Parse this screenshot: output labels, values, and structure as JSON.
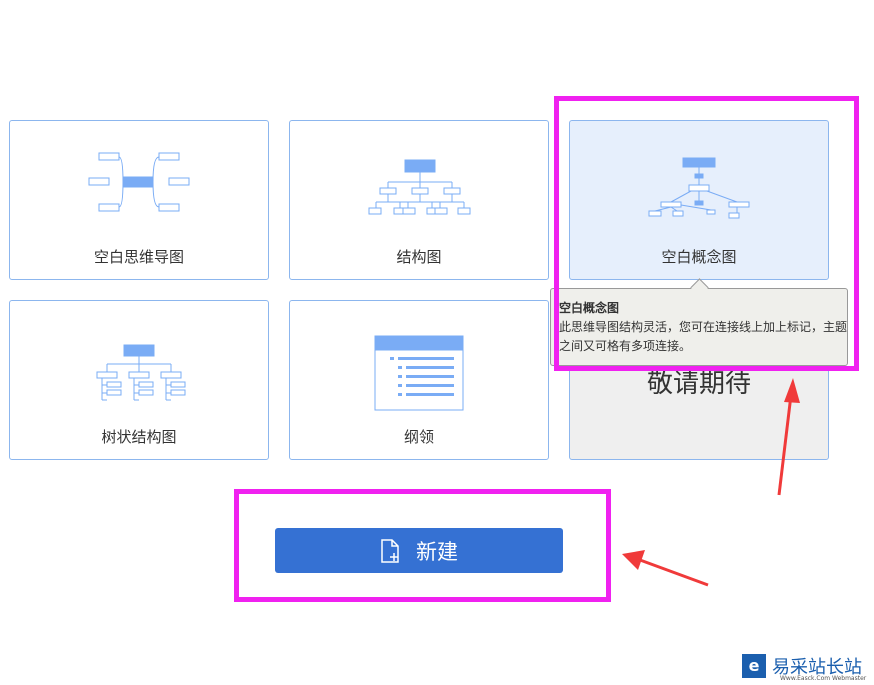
{
  "templates": [
    {
      "label": "空白思维导图",
      "icon": "mindmap-icon"
    },
    {
      "label": "结构图",
      "icon": "org-chart-icon"
    },
    {
      "label": "空白概念图",
      "icon": "concept-map-icon"
    },
    {
      "label": "树状结构图",
      "icon": "tree-chart-icon"
    },
    {
      "label": "纲领",
      "icon": "outline-icon"
    },
    {
      "label": "敬请期待",
      "icon": ""
    }
  ],
  "tooltip": {
    "title": "空白概念图",
    "text": "此思维导图结构灵活，您可在连接线上加上标记，主题之间又可格有多项连接。"
  },
  "new_button": {
    "label": "新建",
    "icon": "new-file-icon"
  },
  "watermark": {
    "name": "易采站长站",
    "sub": "Www.Easck.Com Webmaster"
  },
  "colors": {
    "accent": "#3571d3",
    "icon": "#7aacf5",
    "highlight": "#f021f0",
    "arrow": "#f03a3a"
  }
}
